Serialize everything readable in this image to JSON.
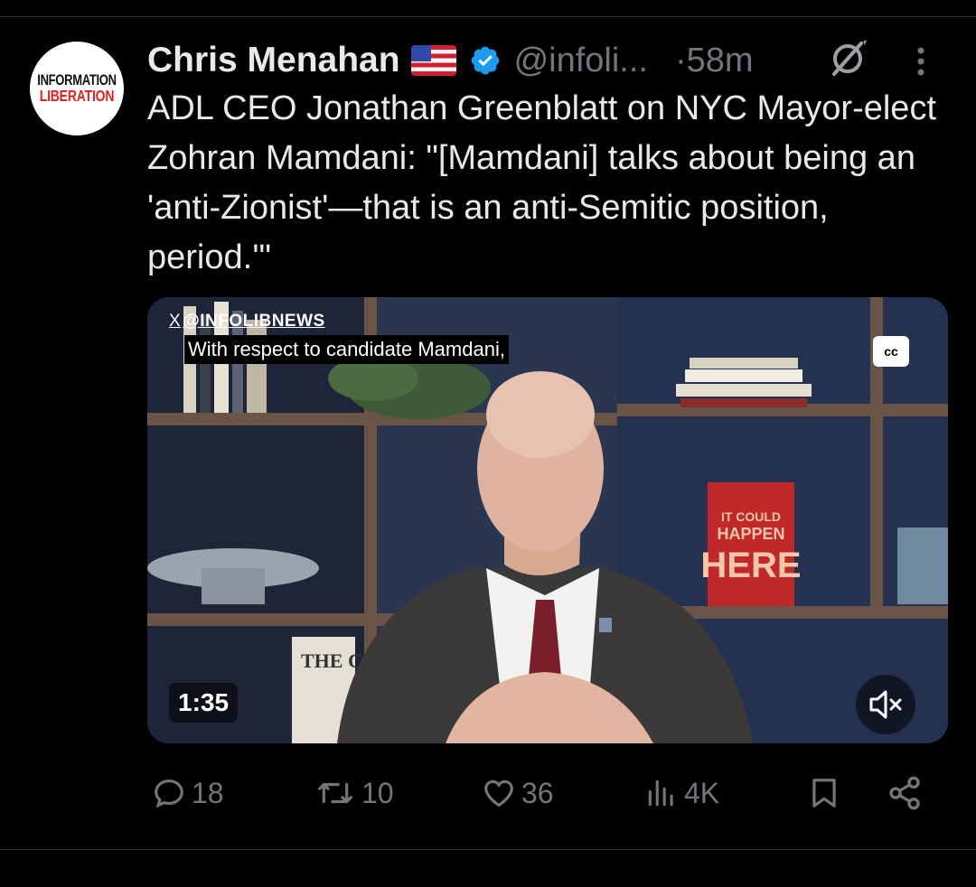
{
  "post": {
    "avatar": {
      "line1": "INFORMATION",
      "line2": "LIBERATION"
    },
    "author_name": "Chris Menahan",
    "handle": "@infoli...",
    "time": "58m",
    "time_separator": "·",
    "text": "ADL CEO Jonathan Greenblatt on NYC Mayor-elect Zohran Mamdani: \"[Mamdani] talks about being an 'anti-Zionist'—that is an anti-Semitic position, period.'\"",
    "icons": {
      "flag": "us-flag-icon",
      "verified": "verified-badge-icon",
      "grok": "grok-icon",
      "more": "more-vertical-icon"
    }
  },
  "video": {
    "watermark_x": "X",
    "watermark": "@INFOLIBNEWS",
    "caption": "With respect to candidate Mamdani,",
    "cc_label": "cc",
    "duration": "1:35",
    "book_titles": [
      "IT COULD",
      "HAPPEN",
      "HERE"
    ],
    "book2_title": "THE C",
    "mute_icon": "muted-speaker-icon"
  },
  "actions": {
    "replies": "18",
    "reposts": "10",
    "likes": "36",
    "views": "4K",
    "icons": [
      "reply-icon",
      "repost-icon",
      "like-icon",
      "views-icon",
      "bookmark-icon",
      "share-icon"
    ]
  },
  "colors": {
    "background": "#000000",
    "text": "#e7e9ea",
    "muted": "#71767b",
    "verified": "#1d9bf0",
    "divider": "#2f3336"
  }
}
